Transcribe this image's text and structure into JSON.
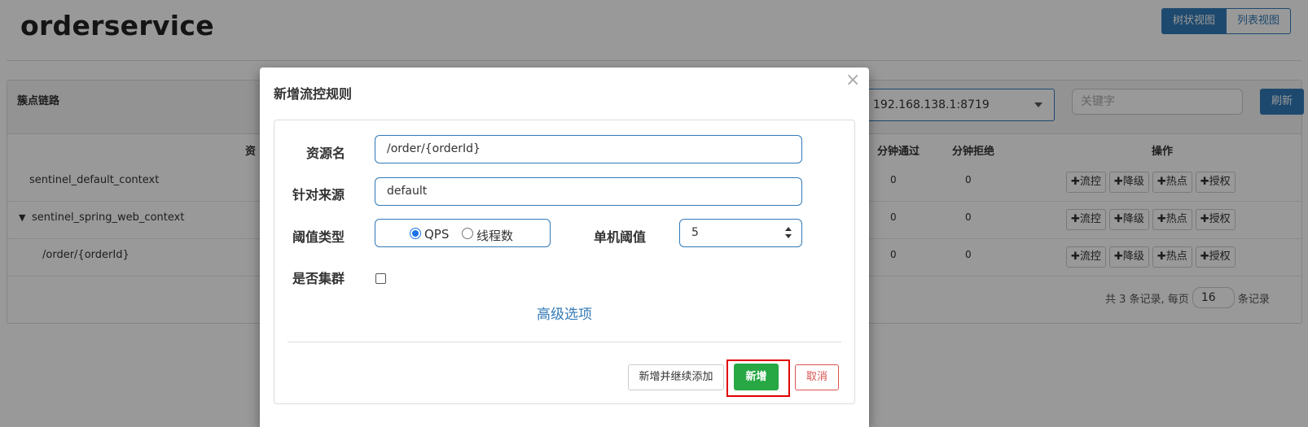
{
  "header": {
    "app_name": "orderservice",
    "view_toggle": {
      "tree_view": "树状视图",
      "list_view": "列表视图"
    }
  },
  "panel": {
    "title": "簇点链路",
    "machine": "192.168.138.1:8719",
    "keyword_placeholder": "关键字",
    "refresh": "刷新"
  },
  "table": {
    "headers": {
      "resource": "资",
      "pass_per_min": "分钟通过",
      "block_per_min": "分钟拒绝",
      "actions": "操作"
    },
    "rows": [
      {
        "name": "sentinel_default_context",
        "pass": "0",
        "block": "0"
      },
      {
        "expand_icon": "▼",
        "name": "sentinel_spring_web_context",
        "pass": "0",
        "block": "0"
      },
      {
        "name": "/order/{orderId}",
        "pass": "0",
        "block": "0"
      }
    ],
    "op_labels": {
      "flow": "流控",
      "degrade": "降级",
      "hot": "热点",
      "auth": "授权",
      "plus": "✚"
    },
    "pager": {
      "prefix": "共 3 条记录, 每页",
      "page_size": "16",
      "suffix": "条记录"
    }
  },
  "modal": {
    "title": "新增流控规则",
    "close": "×",
    "fields": {
      "resource_label": "资源名",
      "resource_value": "/order/{orderId}",
      "origin_label": "针对来源",
      "origin_value": "default",
      "threshold_type_label": "阈值类型",
      "threshold_type_options": [
        "QPS",
        "线程数"
      ],
      "threshold_type_selected": "QPS",
      "threshold_label": "单机阈值",
      "threshold_value": "5",
      "cluster_label": "是否集群"
    },
    "advanced": "高级选项",
    "buttons": {
      "add_continue": "新增并继续添加",
      "add": "新增",
      "cancel": "取消"
    }
  },
  "colors": {
    "primary": "#337ab7",
    "success": "#28a745",
    "danger": "#d9534f",
    "highlight": "#e00000"
  }
}
